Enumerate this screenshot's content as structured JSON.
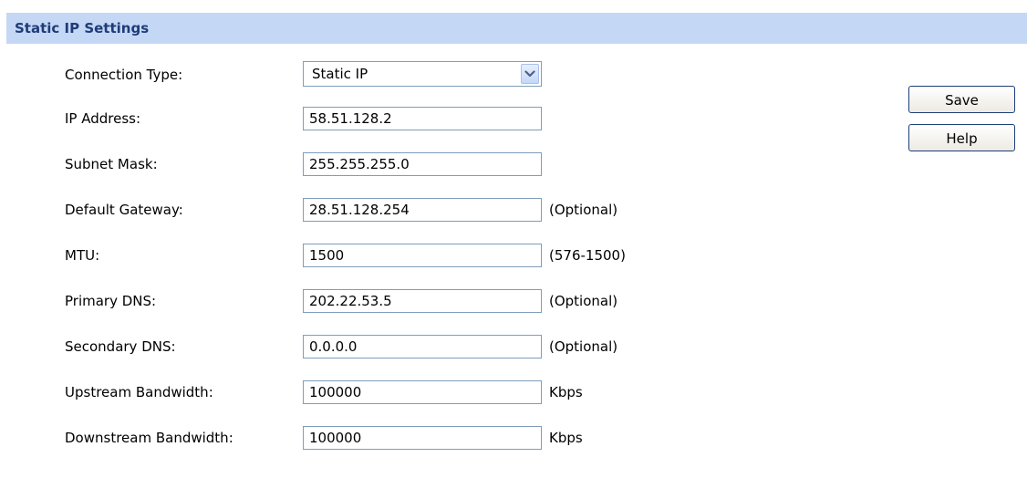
{
  "section": {
    "title": "Static IP Settings"
  },
  "form": {
    "connection_type": {
      "label": "Connection Type:",
      "value": "Static IP"
    },
    "fields": [
      {
        "label": "IP Address:",
        "value": "58.51.128.2",
        "hint": ""
      },
      {
        "label": "Subnet Mask:",
        "value": "255.255.255.0",
        "hint": ""
      },
      {
        "label": "Default Gateway:",
        "value": "28.51.128.254",
        "hint": "(Optional)"
      },
      {
        "label": "MTU:",
        "value": "1500",
        "hint": "(576-1500)"
      },
      {
        "label": "Primary DNS:",
        "value": "202.22.53.5",
        "hint": "(Optional)"
      },
      {
        "label": "Secondary DNS:",
        "value": "0.0.0.0",
        "hint": "(Optional)"
      },
      {
        "label": "Upstream Bandwidth:",
        "value": "100000",
        "hint": "Kbps"
      },
      {
        "label": "Downstream Bandwidth:",
        "value": "100000",
        "hint": "Kbps"
      }
    ]
  },
  "buttons": {
    "save_label": "Save",
    "help_label": "Help"
  },
  "icons": {
    "select_arrow": "chevron-down-icon"
  },
  "colors": {
    "header_background": "#c4d8f6",
    "header_text": "#1f3c78",
    "field_border": "#7f9db9",
    "button_border": "#1c3f7a"
  }
}
